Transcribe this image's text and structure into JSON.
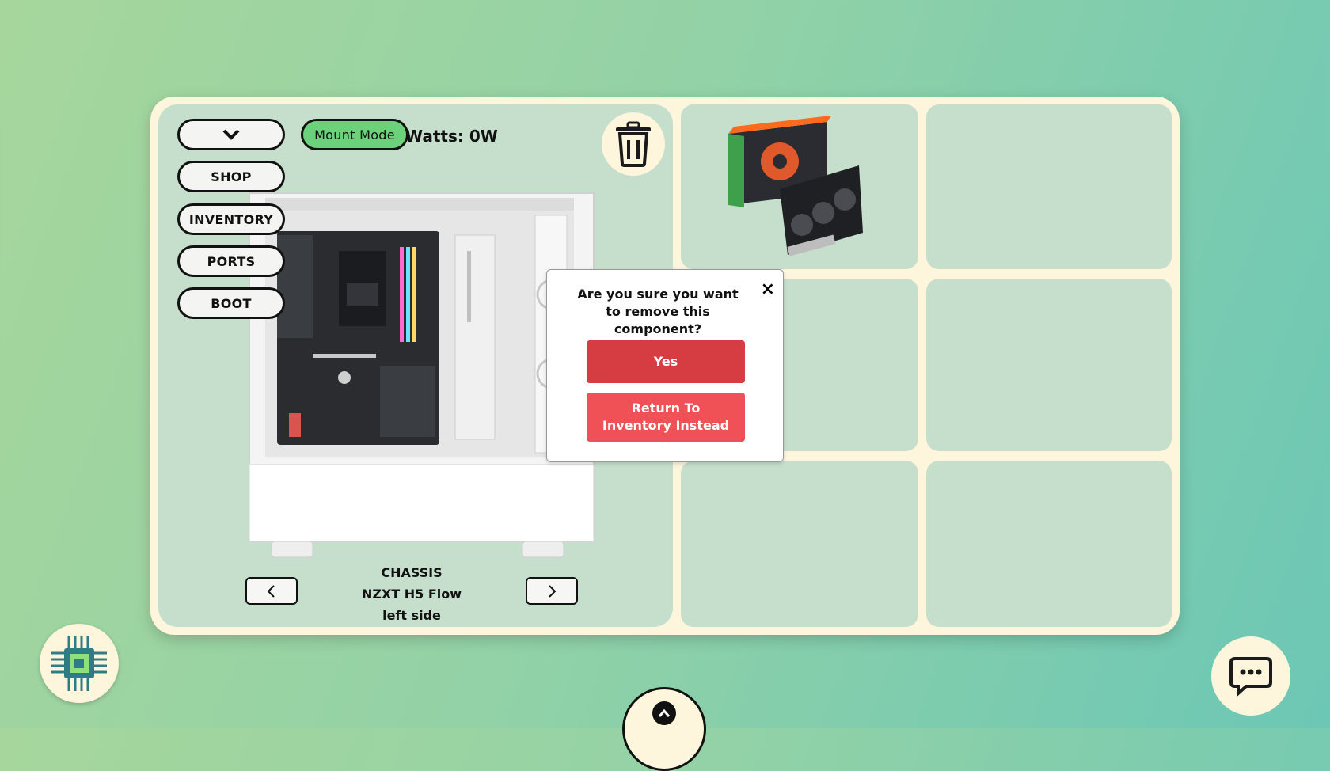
{
  "toolbar": {
    "dropdown_icon": "chevron-down-icon",
    "mount_mode_label": "Mount Mode",
    "watts_label": "Watts: 0W"
  },
  "menu": {
    "shop": "SHOP",
    "inventory": "INVENTORY",
    "ports": "PORTS",
    "boot": "BOOT"
  },
  "chassis": {
    "category": "CHASSIS",
    "name": "NZXT H5 Flow",
    "view": "left side",
    "prev_icon": "chevron-left-icon",
    "next_icon": "chevron-right-icon"
  },
  "inventory_slots": [
    {
      "item": "GIGABYTE GeForce RTX graphics card"
    },
    {
      "item": ""
    },
    {
      "item": ""
    },
    {
      "item": ""
    },
    {
      "item": ""
    },
    {
      "item": ""
    }
  ],
  "dialog": {
    "message": "Are you sure you want to remove this component?",
    "close": "×",
    "yes_label": "Yes",
    "return_label": "Return To Inventory Instead"
  },
  "colors": {
    "mount_mode": "#6bd17a",
    "yes_button": "#d63d42",
    "return_button": "#ef5156",
    "panel": "#fdf5dc",
    "slot": "#c6dfcc"
  }
}
